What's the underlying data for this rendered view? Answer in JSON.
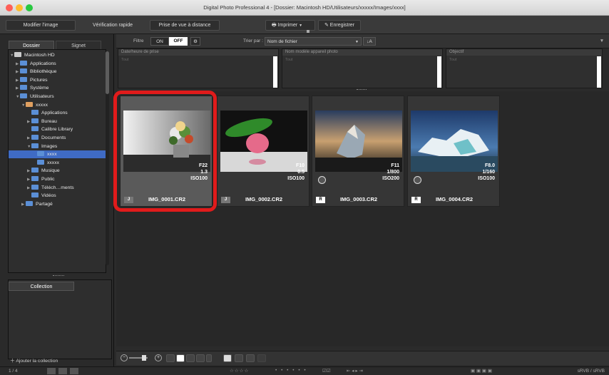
{
  "window": {
    "title": "Digital Photo Professional 4 - [Dossier: Macintosh HD/Utilisateurs/xxxxx/Images/xxxx]"
  },
  "toolbar": {
    "edit_image": "Modifier l'image",
    "quick_check": "Vérification rapide",
    "remote_shooting": "Prise de vue à distance",
    "print": "Imprimer",
    "save": "Enregistrer"
  },
  "filterbar": {
    "filter_label": "Filtre",
    "on": "ON",
    "off": "OFF",
    "sort_label": "Trier par :",
    "sort_value": "Nom de fichier"
  },
  "left_tabs": {
    "folder": "Dossier",
    "bookmark": "Signet"
  },
  "tree": [
    {
      "label": "Macintosh HD",
      "arrow": "▼"
    },
    {
      "label": "Applications",
      "arrow": "▶"
    },
    {
      "label": "Bibliothèque",
      "arrow": "▶"
    },
    {
      "label": "Pictures",
      "arrow": "▶"
    },
    {
      "label": "Système",
      "arrow": "▶"
    },
    {
      "label": "Utilisateurs",
      "arrow": "▼"
    },
    {
      "label": "xxxxx",
      "arrow": "▼"
    },
    {
      "label": "Applications",
      "arrow": ""
    },
    {
      "label": "Bureau",
      "arrow": "▶"
    },
    {
      "label": "Calibre Library",
      "arrow": ""
    },
    {
      "label": "Documents",
      "arrow": "▶"
    },
    {
      "label": "Images",
      "arrow": "▼"
    },
    {
      "label": "xxxx",
      "arrow": ""
    },
    {
      "label": "xxxxx",
      "arrow": ""
    },
    {
      "label": "Musique",
      "arrow": "▶"
    },
    {
      "label": "Public",
      "arrow": "▶"
    },
    {
      "label": "Téléch…ments",
      "arrow": "▶"
    },
    {
      "label": "Vidéos",
      "arrow": ""
    },
    {
      "label": "Partagé",
      "arrow": "▶"
    }
  ],
  "collection": {
    "tab": "Collection",
    "add": "Ajouter la collection"
  },
  "filters": [
    {
      "header": "Date/heure de prise",
      "value": "Tout"
    },
    {
      "header": "Nom modèle appareil photo",
      "value": "Tout"
    },
    {
      "header": "Objectif",
      "value": "Tout"
    }
  ],
  "images": [
    {
      "name": "IMG_0001.CR2",
      "aperture": "F22",
      "shutter": "1.3",
      "iso": "ISO100",
      "badge": "J"
    },
    {
      "name": "IMG_0002.CR2",
      "aperture": "F10",
      "shutter": "0.5",
      "iso": "ISO100",
      "badge": "J"
    },
    {
      "name": "IMG_0003.CR2",
      "aperture": "F11",
      "shutter": "1/800",
      "iso": "ISO200",
      "badge": "R"
    },
    {
      "name": "IMG_0004.CR2",
      "aperture": "F8.0",
      "shutter": "1/160",
      "iso": "ISO100",
      "badge": "R"
    }
  ],
  "status": {
    "count": "1 / 4",
    "colorspace": "sRVB / sRVB"
  }
}
